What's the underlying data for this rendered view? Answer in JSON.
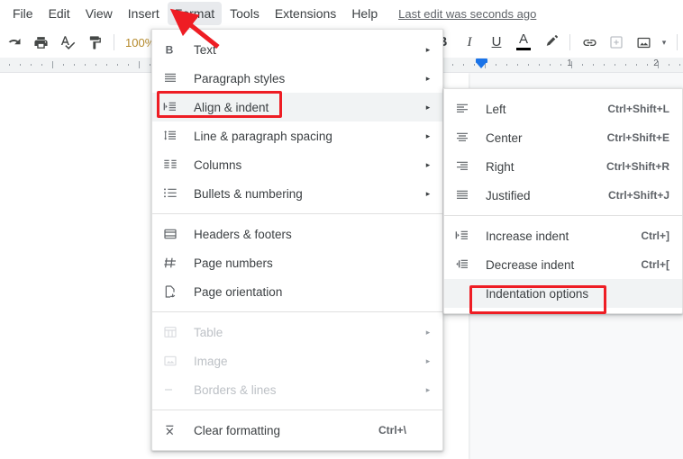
{
  "menubar": {
    "items": [
      {
        "label": "File",
        "active": false
      },
      {
        "label": "Edit",
        "active": false
      },
      {
        "label": "View",
        "active": false
      },
      {
        "label": "Insert",
        "active": false
      },
      {
        "label": "Format",
        "active": true
      },
      {
        "label": "Tools",
        "active": false
      },
      {
        "label": "Extensions",
        "active": false
      },
      {
        "label": "Help",
        "active": false
      }
    ],
    "last_edit": "Last edit was seconds ago"
  },
  "toolbar": {
    "zoom_value": "100%",
    "zoom_caret": "▾",
    "buttons": [
      {
        "name": "redo-icon"
      },
      {
        "name": "print-icon"
      },
      {
        "name": "spelling-check-icon"
      },
      {
        "name": "paint-format-icon"
      }
    ],
    "text_buttons": [
      {
        "name": "bold-button",
        "label": "B"
      },
      {
        "name": "italic-button",
        "label": "I"
      },
      {
        "name": "underline-button",
        "label": "U"
      },
      {
        "name": "text-color-button",
        "label": "A"
      },
      {
        "name": "highlight-color-button",
        "label": ""
      }
    ],
    "insert_buttons": [
      {
        "name": "insert-link-icon"
      },
      {
        "name": "add-comment-icon"
      },
      {
        "name": "insert-image-icon"
      }
    ],
    "image_caret": "▾"
  },
  "ruler": {
    "numbers": [
      "1",
      "2"
    ],
    "indent_marker": "left-indent-marker"
  },
  "format_menu": {
    "items": [
      {
        "label": "Text",
        "icon": "bold-text-icon",
        "arrow": "▸",
        "accel": "",
        "type": "item",
        "disabled": false,
        "highlight": false
      },
      {
        "label": "Paragraph styles",
        "icon": "paragraph-styles-icon",
        "arrow": "▸",
        "accel": "",
        "type": "item",
        "disabled": false,
        "highlight": false
      },
      {
        "label": "Align & indent",
        "icon": "align-indent-icon",
        "arrow": "▸",
        "accel": "",
        "type": "item",
        "disabled": false,
        "highlight": true
      },
      {
        "label": "Line & paragraph spacing",
        "icon": "line-spacing-icon",
        "arrow": "▸",
        "accel": "",
        "type": "item",
        "disabled": false,
        "highlight": false
      },
      {
        "label": "Columns",
        "icon": "columns-icon",
        "arrow": "▸",
        "accel": "",
        "type": "item",
        "disabled": false,
        "highlight": false
      },
      {
        "label": "Bullets & numbering",
        "icon": "bullets-numbering-icon",
        "arrow": "▸",
        "accel": "",
        "type": "item",
        "disabled": false,
        "highlight": false
      },
      {
        "type": "separator"
      },
      {
        "label": "Headers & footers",
        "icon": "headers-footers-icon",
        "arrow": "",
        "accel": "",
        "type": "item",
        "disabled": false,
        "highlight": false
      },
      {
        "label": "Page numbers",
        "icon": "page-numbers-icon",
        "arrow": "",
        "accel": "",
        "type": "item",
        "disabled": false,
        "highlight": false
      },
      {
        "label": "Page orientation",
        "icon": "page-orientation-icon",
        "arrow": "",
        "accel": "",
        "type": "item",
        "disabled": false,
        "highlight": false
      },
      {
        "type": "separator"
      },
      {
        "label": "Table",
        "icon": "table-icon",
        "arrow": "▸",
        "accel": "",
        "type": "item",
        "disabled": true,
        "highlight": false
      },
      {
        "label": "Image",
        "icon": "image-icon",
        "arrow": "▸",
        "accel": "",
        "type": "item",
        "disabled": true,
        "highlight": false
      },
      {
        "label": "Borders & lines",
        "icon": "borders-lines-icon",
        "arrow": "▸",
        "accel": "",
        "type": "item",
        "disabled": true,
        "highlight": false
      },
      {
        "type": "separator"
      },
      {
        "label": "Clear formatting",
        "icon": "clear-formatting-icon",
        "arrow": "",
        "accel": "Ctrl+\\",
        "type": "item",
        "disabled": false,
        "highlight": false
      }
    ]
  },
  "align_submenu": {
    "items": [
      {
        "label": "Left",
        "icon": "align-left-icon",
        "accel": "Ctrl+Shift+L",
        "type": "item",
        "highlight": false
      },
      {
        "label": "Center",
        "icon": "align-center-icon",
        "accel": "Ctrl+Shift+E",
        "type": "item",
        "highlight": false
      },
      {
        "label": "Right",
        "icon": "align-right-icon",
        "accel": "Ctrl+Shift+R",
        "type": "item",
        "highlight": false
      },
      {
        "label": "Justified",
        "icon": "align-justify-icon",
        "accel": "Ctrl+Shift+J",
        "type": "item",
        "highlight": false
      },
      {
        "type": "separator"
      },
      {
        "label": "Increase indent",
        "icon": "increase-indent-icon",
        "accel": "Ctrl+]",
        "type": "item",
        "highlight": false
      },
      {
        "label": "Decrease indent",
        "icon": "decrease-indent-icon",
        "accel": "Ctrl+[",
        "type": "item",
        "highlight": false
      },
      {
        "label": "Indentation options",
        "icon": "",
        "accel": "",
        "type": "item",
        "highlight": true
      }
    ]
  },
  "annotations": {
    "highlight_color": "#ee1d24",
    "boxes": [
      "align-indent-highlight-box",
      "indentation-options-highlight-box"
    ],
    "arrow": "format-menu-pointer-arrow"
  }
}
